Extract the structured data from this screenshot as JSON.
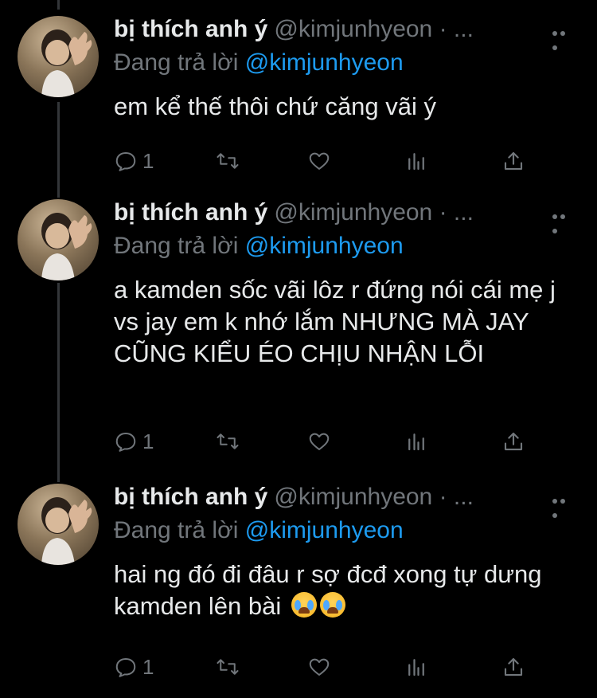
{
  "tweets": [
    {
      "name": "bị thích anh ý",
      "handle": "@kimjunhyeon · ...",
      "reply_prefix": "Đang trả lời",
      "reply_mention": "@kimjunhyeon",
      "text": "em kể thế thôi chứ căng vãi ý",
      "reply_count": "1"
    },
    {
      "name": "bị thích anh ý",
      "handle": "@kimjunhyeon · ...",
      "reply_prefix": "Đang trả lời",
      "reply_mention": "@kimjunhyeon",
      "text": "a kamden sốc vãi lôz r đứng nói cái mẹ j vs jay em k nhớ lắm NHƯNG MÀ JAY CŨNG KIỂU ÉO CHỊU NHẬN LỖI",
      "reply_count": "1"
    },
    {
      "name": "bị thích anh ý",
      "handle": "@kimjunhyeon · ...",
      "reply_prefix": "Đang trả lời",
      "reply_mention": "@kimjunhyeon",
      "text": "hai ng đó đi đâu r sợ đcđ xong tự dưng kamden lên bài",
      "reply_count": "1"
    }
  ],
  "icons": {
    "reply": "reply-icon",
    "retweet": "retweet-icon",
    "like": "heart-icon",
    "views": "analytics-icon",
    "share": "share-icon",
    "more": "more-icon",
    "emoji": "loudly-crying-face-emoji"
  },
  "colors": {
    "background": "#000000",
    "text": "#e7e9ea",
    "secondary": "#71767b",
    "mention": "#1d9bf0",
    "thread_line": "#333639"
  }
}
